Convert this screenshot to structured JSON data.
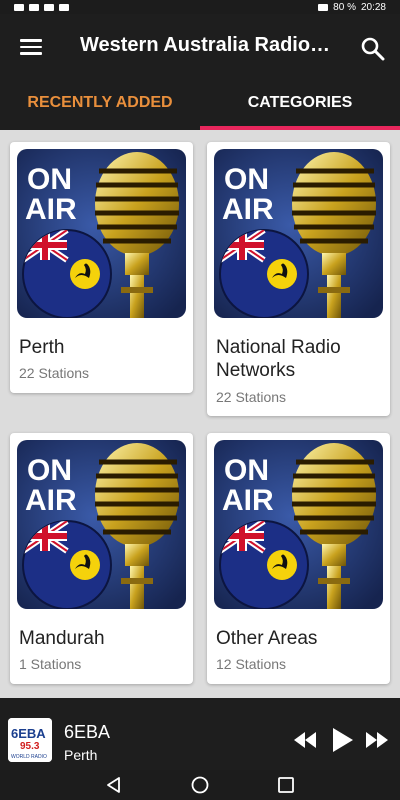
{
  "app": {
    "title": "Western Australia Radio…"
  },
  "tabs": [
    {
      "label": "RECENTLY ADDED"
    },
    {
      "label": "CATEGORIES"
    }
  ],
  "categories": [
    {
      "name": "Perth",
      "count": "22 Stations",
      "thumb_text": [
        "ON",
        "AIR"
      ]
    },
    {
      "name": "National Radio Networks",
      "count": "22 Stations",
      "thumb_text": [
        "ON",
        "AIR"
      ]
    },
    {
      "name": "Mandurah",
      "count": "1 Stations",
      "thumb_text": [
        "ON",
        "AIR"
      ]
    },
    {
      "name": "Other Areas",
      "count": "12 Stations",
      "thumb_text": [
        "ON",
        "AIR"
      ]
    }
  ],
  "player": {
    "title": "6EBA",
    "subtitle": "Perth",
    "logo_text": "6EBA",
    "logo_freq": "95.3",
    "logo_sub": "WORLD RADIO"
  },
  "status": {
    "battery": "80 %",
    "time": "20:28"
  },
  "colors": {
    "accent_tab_active": "#e8275d",
    "tab_recent": "#e98f3c",
    "bar": "#1e1e1e",
    "background": "#dcdcdc"
  },
  "icons": [
    "menu-icon",
    "search-icon",
    "rewind-icon",
    "play-icon",
    "fast-forward-icon",
    "back-icon",
    "home-icon",
    "recents-icon"
  ]
}
